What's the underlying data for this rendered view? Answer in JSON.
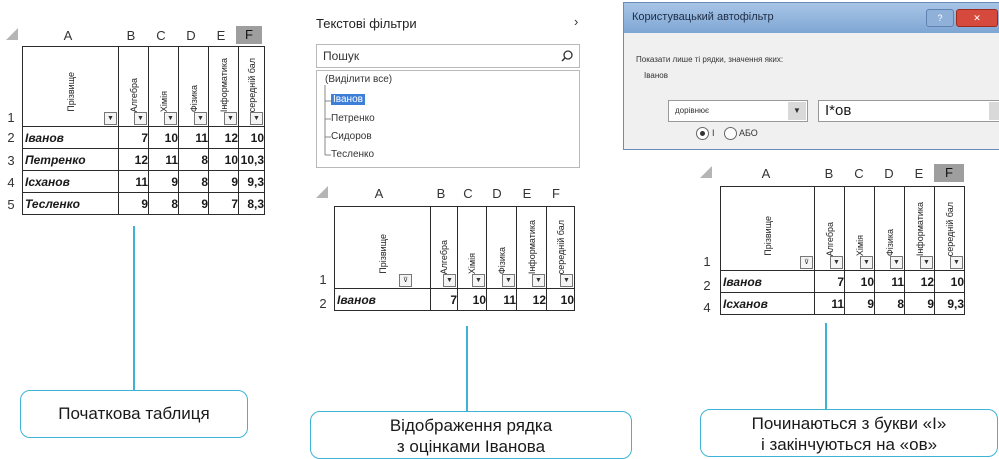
{
  "table1": {
    "columns": [
      "A",
      "B",
      "C",
      "D",
      "E",
      "F"
    ],
    "header_labels": [
      "Прізвище",
      "Алгебра",
      "Хімія",
      "Фізика",
      "Інформатика",
      "середній бал"
    ],
    "rows": [
      {
        "num": "1"
      },
      {
        "num": "2",
        "cells": [
          "Іванов",
          "7",
          "10",
          "11",
          "12",
          "10"
        ]
      },
      {
        "num": "3",
        "cells": [
          "Петренко",
          "12",
          "11",
          "8",
          "10",
          "10,3"
        ]
      },
      {
        "num": "4",
        "cells": [
          "Ісханов",
          "11",
          "9",
          "8",
          "9",
          "9,3"
        ]
      },
      {
        "num": "5",
        "cells": [
          "Тесленко",
          "9",
          "8",
          "9",
          "7",
          "8,3"
        ]
      }
    ]
  },
  "filter_panel": {
    "title": "Текстові фільтри",
    "arrow": "›",
    "search_placeholder": "Пошук",
    "items": [
      "(Виділити все)",
      "Іванов",
      "Петренко",
      "Сидоров",
      "Тесленко"
    ]
  },
  "dialog": {
    "title": "Користувацький автофільтр",
    "prompt": "Показати лише ті рядки, значення яких:",
    "field": "Іванов",
    "operator": "дорівнює",
    "value": "І*ов",
    "and_label": "І",
    "or_label": "АБО"
  },
  "table2": {
    "columns": [
      "A",
      "B",
      "C",
      "D",
      "E",
      "F"
    ],
    "header_labels": [
      "Прізвище",
      "Алгебра",
      "Хімія",
      "Фізика",
      "Інформатика",
      "середній бал"
    ],
    "rows": [
      {
        "num": "1"
      },
      {
        "num": "2",
        "cells": [
          "Іванов",
          "7",
          "10",
          "11",
          "12",
          "10"
        ]
      }
    ]
  },
  "table3": {
    "columns": [
      "A",
      "B",
      "C",
      "D",
      "E",
      "F"
    ],
    "header_labels": [
      "Прізвище",
      "Алгебра",
      "Хімія",
      "Фізика",
      "Інформатика",
      "середній бал"
    ],
    "rows": [
      {
        "num": "1"
      },
      {
        "num": "2",
        "cells": [
          "Іванов",
          "7",
          "10",
          "11",
          "12",
          "10"
        ]
      },
      {
        "num": "4",
        "cells": [
          "Ісханов",
          "11",
          "9",
          "8",
          "9",
          "9,3"
        ]
      }
    ]
  },
  "callouts": {
    "left": "Початкова таблиця",
    "middle_line1": "Відображення рядка",
    "middle_line2": "з оцінками Іванова",
    "right_line1": "Починаються з букви «І»",
    "right_line2": "і закінчуються на «ов»"
  }
}
